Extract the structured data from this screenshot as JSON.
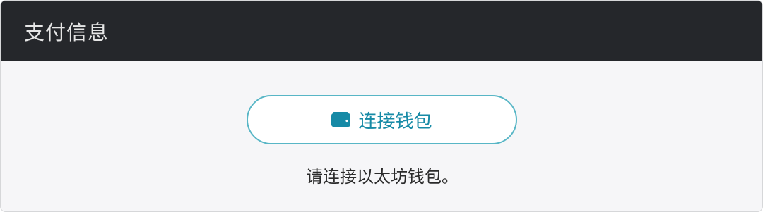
{
  "header": {
    "title": "支付信息"
  },
  "connect_button": {
    "label": "连接钱包",
    "icon": "wallet-icon",
    "accent_color": "#168aa6",
    "border_color": "#58b6c6"
  },
  "hint": {
    "text": "请连接以太坊钱包。"
  },
  "colors": {
    "header_bg": "#25272b",
    "body_bg": "#f6f6f8"
  }
}
